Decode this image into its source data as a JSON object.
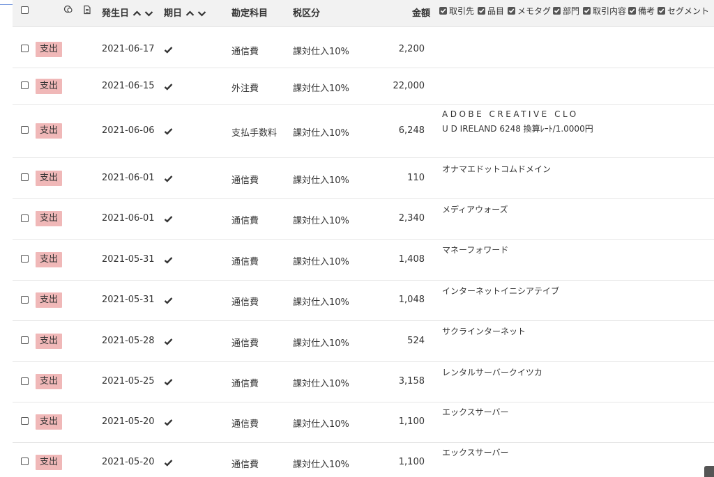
{
  "header": {
    "date_col": "発生日",
    "due_col": "期日",
    "account_col": "勘定科目",
    "tax_col": "税区分",
    "amount_col": "金額",
    "options": [
      "取引先",
      "品目",
      "メモタグ",
      "部門",
      "取引内容",
      "備考",
      "セグメント"
    ]
  },
  "rows": [
    {
      "type": "支出",
      "date": "2021-06-17",
      "account": "通信費",
      "tax": "課対仕入10%",
      "amount": "2,200",
      "desc1": "",
      "desc2": ""
    },
    {
      "type": "支出",
      "date": "2021-06-15",
      "account": "外注費",
      "tax": "課対仕入10%",
      "amount": "22,000",
      "desc1": "",
      "desc2": ""
    },
    {
      "type": "支出",
      "date": "2021-06-06",
      "account": "支払手数料",
      "tax": "課対仕入10%",
      "amount": "6,248",
      "desc1": "ADOBE CREATIVE CLO",
      "desc2": "U D IRELAND 6248 換算ﾚｰﾄ/1.0000円"
    },
    {
      "type": "支出",
      "date": "2021-06-01",
      "account": "通信費",
      "tax": "課対仕入10%",
      "amount": "110",
      "desc1": "オナマエドットコムドメイン",
      "desc2": ""
    },
    {
      "type": "支出",
      "date": "2021-06-01",
      "account": "通信費",
      "tax": "課対仕入10%",
      "amount": "2,340",
      "desc1": "メディアウォーズ",
      "desc2": ""
    },
    {
      "type": "支出",
      "date": "2021-05-31",
      "account": "通信費",
      "tax": "課対仕入10%",
      "amount": "1,408",
      "desc1": "マネーフォワード",
      "desc2": ""
    },
    {
      "type": "支出",
      "date": "2021-05-31",
      "account": "通信費",
      "tax": "課対仕入10%",
      "amount": "1,048",
      "desc1": "インターネットイニシアテイブ",
      "desc2": ""
    },
    {
      "type": "支出",
      "date": "2021-05-28",
      "account": "通信費",
      "tax": "課対仕入10%",
      "amount": "524",
      "desc1": "サクラインターネット",
      "desc2": ""
    },
    {
      "type": "支出",
      "date": "2021-05-25",
      "account": "通信費",
      "tax": "課対仕入10%",
      "amount": "3,158",
      "desc1": "レンタルサーバークイツカ",
      "desc2": ""
    },
    {
      "type": "支出",
      "date": "2021-05-20",
      "account": "通信費",
      "tax": "課対仕入10%",
      "amount": "1,100",
      "desc1": "エックスサーバー",
      "desc2": ""
    },
    {
      "type": "支出",
      "date": "2021-05-20",
      "account": "通信費",
      "tax": "課対仕入10%",
      "amount": "1,100",
      "desc1": "エックスサーバー",
      "desc2": ""
    }
  ]
}
